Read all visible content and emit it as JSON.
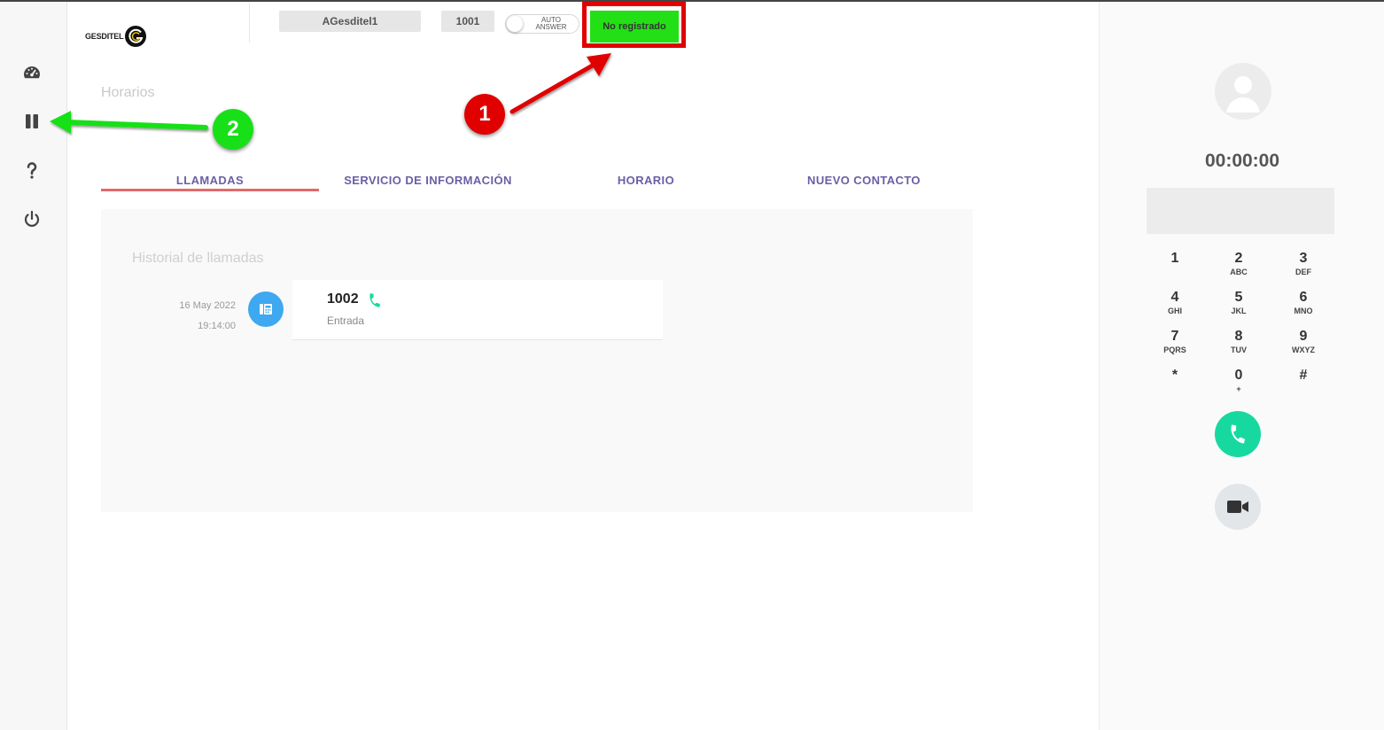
{
  "header": {
    "logo_text": "GESDITEL",
    "username": "AGesditel1",
    "extension": "1001",
    "auto_answer_label": "AUTO ANSWER",
    "status_label": "No registrado"
  },
  "sidebar": {
    "items": [
      {
        "icon": "dashboard-icon"
      },
      {
        "icon": "pause-icon"
      },
      {
        "icon": "help-icon"
      },
      {
        "icon": "power-icon"
      }
    ]
  },
  "page": {
    "title": "Horarios"
  },
  "tabs": [
    {
      "label": "LLAMADAS",
      "active": true
    },
    {
      "label": "SERVICIO DE INFORMACIÓN",
      "active": false
    },
    {
      "label": "HORARIO",
      "active": false
    },
    {
      "label": "NUEVO CONTACTO",
      "active": false
    }
  ],
  "history": {
    "title": "Historial de llamadas",
    "calls": [
      {
        "date": "16 May 2022",
        "time": "19:14:00",
        "number": "1002",
        "type": "Entrada"
      }
    ]
  },
  "annotations": [
    "1",
    "2"
  ],
  "dialer": {
    "timer": "00:00:00",
    "keys": [
      {
        "num": "1",
        "sub": ""
      },
      {
        "num": "2",
        "sub": "ABC"
      },
      {
        "num": "3",
        "sub": "DEF"
      },
      {
        "num": "4",
        "sub": "GHI"
      },
      {
        "num": "5",
        "sub": "JKL"
      },
      {
        "num": "6",
        "sub": "MNO"
      },
      {
        "num": "7",
        "sub": "PQRS"
      },
      {
        "num": "8",
        "sub": "TUV"
      },
      {
        "num": "9",
        "sub": "WXYZ"
      },
      {
        "num": "*",
        "sub": ""
      },
      {
        "num": "0",
        "sub": "+"
      },
      {
        "num": "#",
        "sub": ""
      }
    ]
  },
  "colors": {
    "status_green": "#22e015",
    "annotation_red": "#e00000",
    "annotation_green": "#18e018",
    "tab_text": "#6a5fa6",
    "tab_underline": "#e26a6a",
    "call_button": "#17d9a0",
    "call_icon_bg": "#3ea8f0"
  }
}
